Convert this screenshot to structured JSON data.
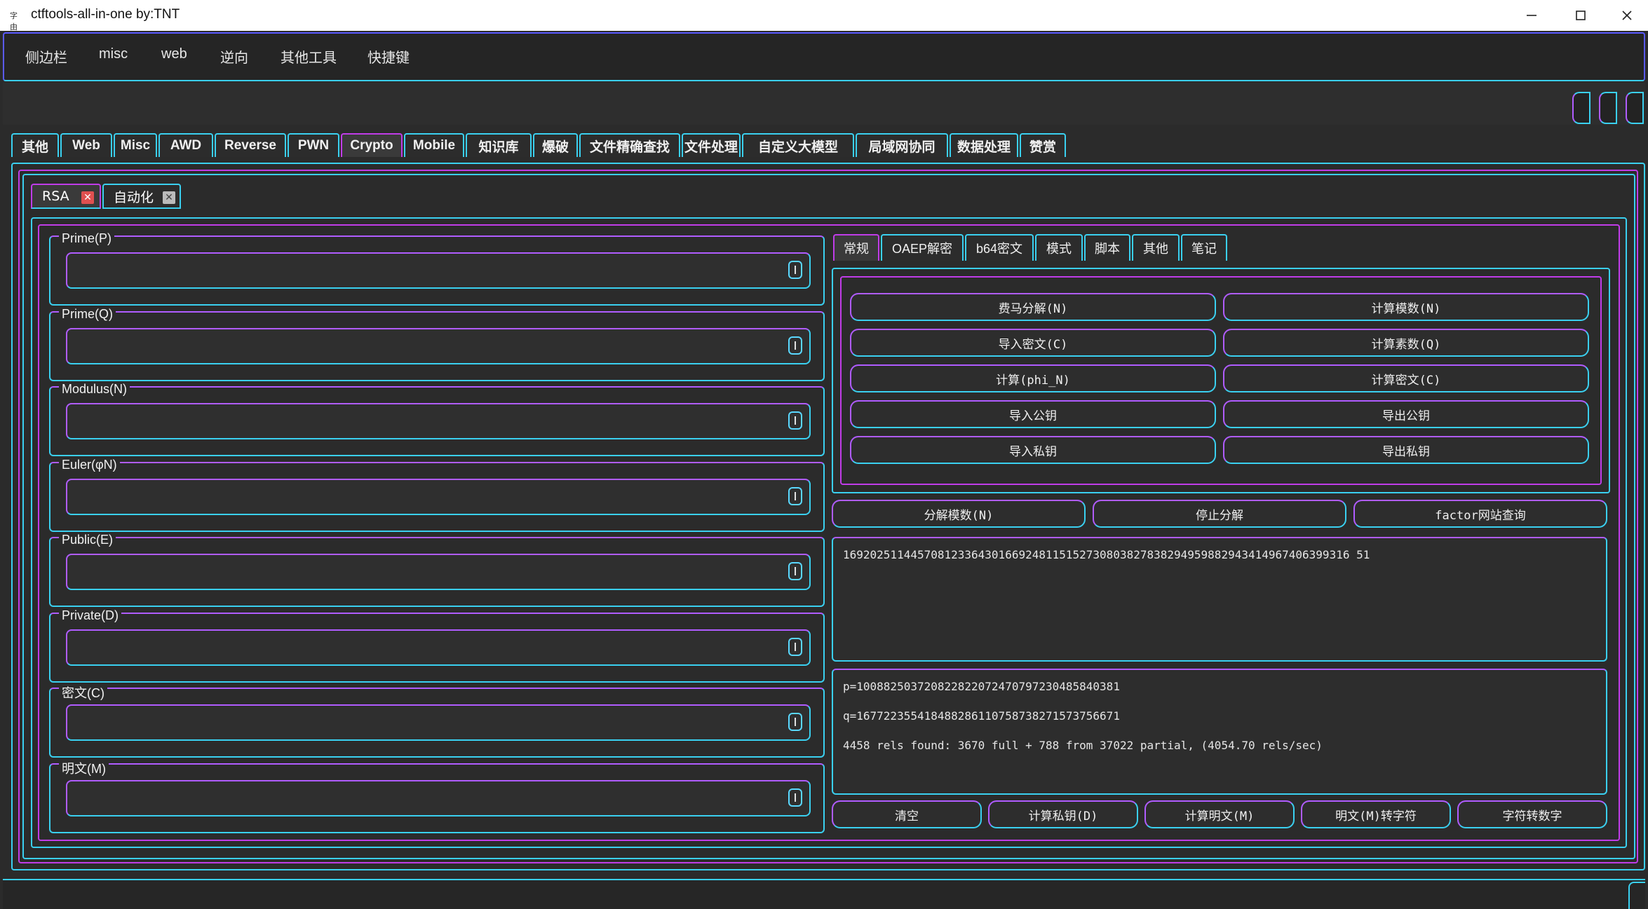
{
  "window": {
    "title": "ctftools-all-in-one   by:TNT",
    "icon_text": "字由"
  },
  "menu": [
    "侧边栏",
    "misc",
    "web",
    "逆向",
    "其他工具",
    "快捷键"
  ],
  "top_tabs": [
    "其他",
    "Web",
    "Misc",
    "AWD",
    "Reverse",
    "PWN",
    "Crypto",
    "Mobile",
    "知识库",
    "爆破",
    "文件精确查找",
    "文件处理",
    "自定义大模型",
    "局域网协同",
    "数据处理",
    "赞赏"
  ],
  "active_top_tab": "Crypto",
  "inner_tabs": [
    "RSA",
    "自动化"
  ],
  "active_inner_tab": "RSA",
  "fields": [
    {
      "label": "Prime(P)",
      "value": ""
    },
    {
      "label": "Prime(Q)",
      "value": ""
    },
    {
      "label": "Modulus(N)",
      "value": ""
    },
    {
      "label": "Euler(φN)",
      "value": ""
    },
    {
      "label": "Public(E)",
      "value": ""
    },
    {
      "label": "Private(D)",
      "value": ""
    },
    {
      "label": "密文(C)",
      "value": ""
    },
    {
      "label": "明文(M)",
      "value": ""
    }
  ],
  "right_tabs": [
    "常规",
    "OAEP解密",
    "b64密文",
    "模式",
    "脚本",
    "其他",
    "笔记"
  ],
  "active_right_tab": "常规",
  "general_buttons": [
    [
      "费马分解(N)",
      "计算模数(N)"
    ],
    [
      "导入密文(C)",
      "计算素数(Q)"
    ],
    [
      "计算(phi_N)",
      "计算密文(C)"
    ],
    [
      "导入公钥",
      "导出公钥"
    ],
    [
      "导入私钥",
      "导出私钥"
    ]
  ],
  "factor_buttons": [
    "分解模数(N)",
    "停止分解",
    "factor网站查询"
  ],
  "modulus_output": "169202511445708123364301669248115152730803827838294959882943414967406399316 51",
  "result_lines": [
    "p=100882503720822822072470797230485840381",
    "q=167722355418488286110758738271573756671",
    "4458 rels found: 3670 full + 788 from 37022 partial, (4054.70 rels/sec)"
  ],
  "bottom_buttons": [
    "清空",
    "计算私钥(D)",
    "计算明文(M)",
    "明文(M)转字符",
    "字符转数字"
  ]
}
